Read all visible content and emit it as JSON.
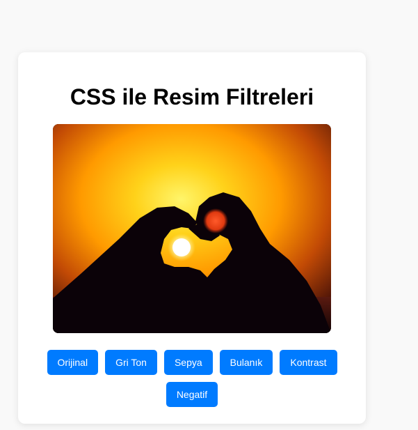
{
  "page": {
    "title": "CSS ile Resim Filtreleri"
  },
  "image": {
    "subject": "heart-hands-sunset"
  },
  "filters": [
    {
      "label": "Orijinal"
    },
    {
      "label": "Gri Ton"
    },
    {
      "label": "Sepya"
    },
    {
      "label": "Bulanık"
    },
    {
      "label": "Kontrast"
    },
    {
      "label": "Negatif"
    }
  ],
  "colors": {
    "page_background": "#f9f9f9",
    "card_background": "#ffffff",
    "button_background": "#007bff",
    "button_text": "#ffffff",
    "title_text": "#000000"
  }
}
